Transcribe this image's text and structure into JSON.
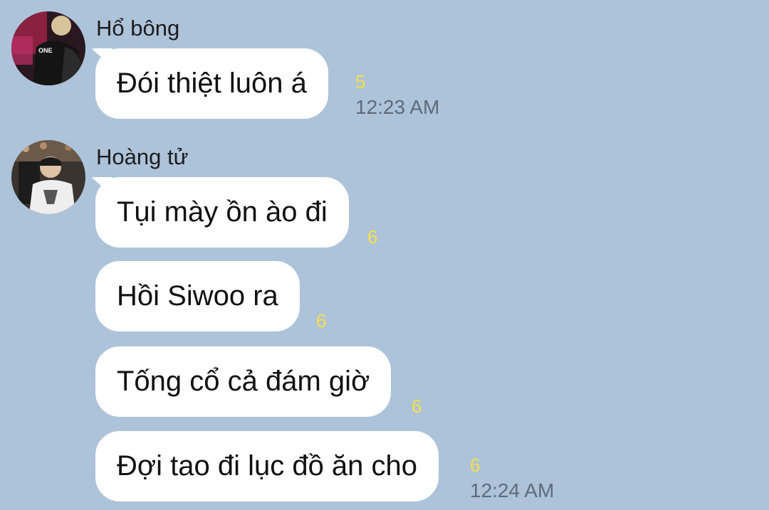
{
  "conversation": {
    "groups": [
      {
        "sender": "Hổ bông",
        "avatar_icon": "user-avatar-icon",
        "messages": [
          {
            "text": "Đói thiệt luôn á",
            "read_count": "5",
            "time": "12:23 AM"
          }
        ]
      },
      {
        "sender": "Hoàng tử",
        "avatar_icon": "user-avatar-icon",
        "messages": [
          {
            "text": "Tụi mày ồn ào đi",
            "read_count": "6",
            "time": ""
          },
          {
            "text": "Hồi Siwoo ra",
            "read_count": "6",
            "time": ""
          },
          {
            "text": "Tống cổ cả đám giờ",
            "read_count": "6",
            "time": ""
          },
          {
            "text": "Đợi tao đi lục đồ ăn cho",
            "read_count": "6",
            "time": "12:24 AM"
          }
        ]
      }
    ]
  },
  "colors": {
    "background": "#adc3da",
    "bubble": "#ffffff",
    "read_count": "#f4e04a",
    "timestamp": "#5e6b78"
  }
}
